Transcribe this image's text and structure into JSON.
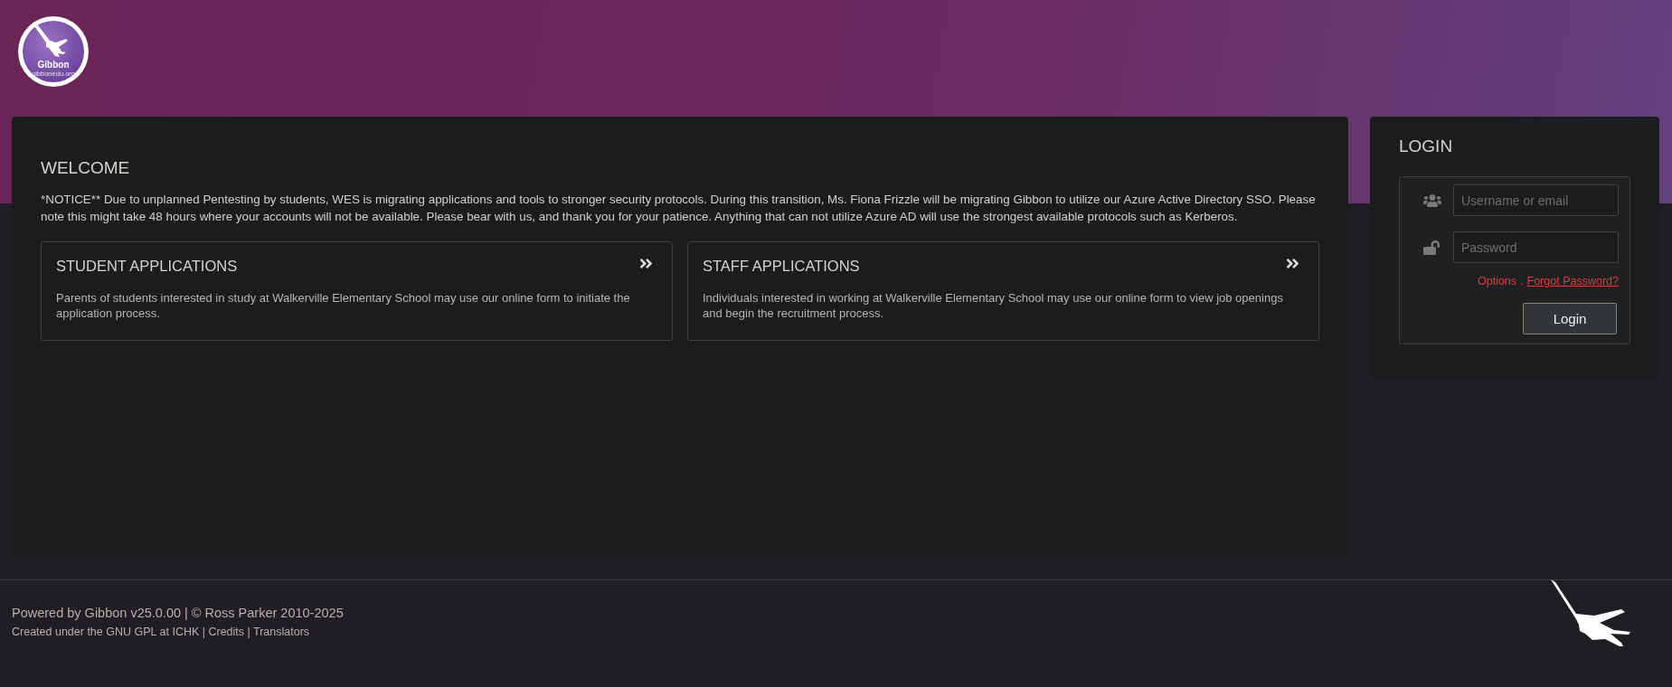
{
  "logo": {
    "name": "Gibbon",
    "site": "gibbonedu.org"
  },
  "welcome": {
    "title": "WELCOME",
    "notice": "*NOTICE** Due to unplanned Pentesting by students, WES is migrating applications and tools to stronger security protocols. During this transition, Ms. Fiona Frizzle will be migrating Gibbon to utilize our Azure Active Directory SSO. Please note this might take 48 hours where your accounts will not be available. Please bear with us, and thank you for your patience. Anything that can not utilize Azure AD will use the strongest available protocols such as Kerberos."
  },
  "cards": [
    {
      "title": "STUDENT APPLICATIONS",
      "description": "Parents of students interested in study at Walkerville Elementary School may use our online form to initiate the application process."
    },
    {
      "title": "STAFF APPLICATIONS",
      "description": "Individuals interested in working at Walkerville Elementary School may use our online form to view job openings and begin the recruitment process."
    }
  ],
  "login": {
    "title": "LOGIN",
    "fields": [
      {
        "kind": "user",
        "placeholder": "Username or email"
      },
      {
        "kind": "password",
        "placeholder": "Password"
      }
    ],
    "options_link": "Options",
    "separator": ".",
    "forgot_link": "Forgot Password?",
    "button": "Login"
  },
  "footer": {
    "line_1": "Powered by Gibbon v25.0.00 | © Ross Parker 2010-2025",
    "line_2": "Created under the GNU GPL at ICHK | Credits | Translators"
  }
}
